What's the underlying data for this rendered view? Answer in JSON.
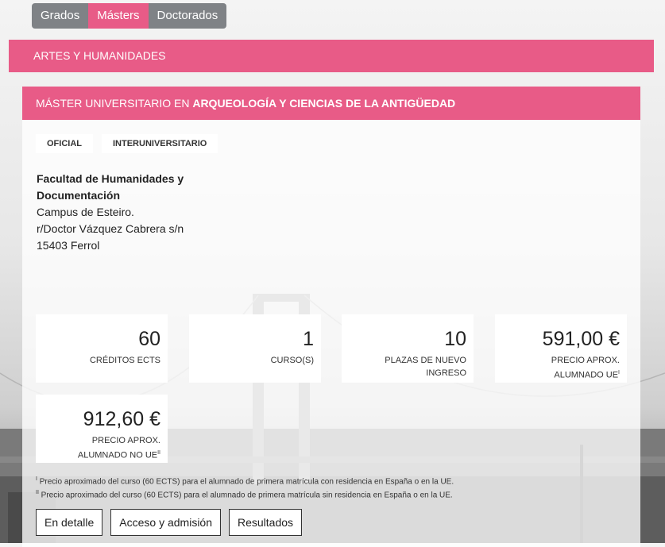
{
  "tabs": [
    {
      "label": "Grados",
      "active": false
    },
    {
      "label": "Másters",
      "active": true
    },
    {
      "label": "Doctorados",
      "active": false
    }
  ],
  "category": "ARTES Y HUMANIDADES",
  "program": {
    "title_prefix": "MÁSTER UNIVERSITARIO EN",
    "title_name": "ARQUEOLOGÍA Y CIENCIAS DE LA ANTIGÜEDAD",
    "badges": [
      "OFICIAL",
      "INTERUNIVERSITARIO"
    ],
    "faculty": "Facultad de Humanidades y Documentación",
    "address_lines": [
      "Campus de Esteiro.",
      "r/Doctor Vázquez Cabrera s/n",
      "15403 Ferrol"
    ],
    "stats": [
      {
        "value": "60",
        "label": "CRÉDITOS ECTS"
      },
      {
        "value": "1",
        "label": "CURSO(S)"
      },
      {
        "value": "10",
        "label": "PLAZAS DE NUEVO INGRESO"
      },
      {
        "value": "591,00 €",
        "label": "PRECIO APROX. ALUMNADO UE",
        "sup": "I"
      },
      {
        "value": "912,60 €",
        "label": "PRECIO APROX. ALUMNADO NO UE",
        "sup": "II"
      }
    ],
    "notes": [
      {
        "sup": "I",
        "text": "Precio aproximado del curso (60 ECTS) para el alumnado de primera matrícula con residencia en España o en la UE."
      },
      {
        "sup": "II",
        "text": "Precio aproximado del curso (60 ECTS) para el alumnado de primera matrícula sin residencia en España o en la UE."
      }
    ],
    "buttons": [
      "En detalle",
      "Acceso y admisión",
      "Resultados"
    ]
  },
  "colors": {
    "accent": "#e85b87",
    "tab_inactive": "#7f8286"
  }
}
